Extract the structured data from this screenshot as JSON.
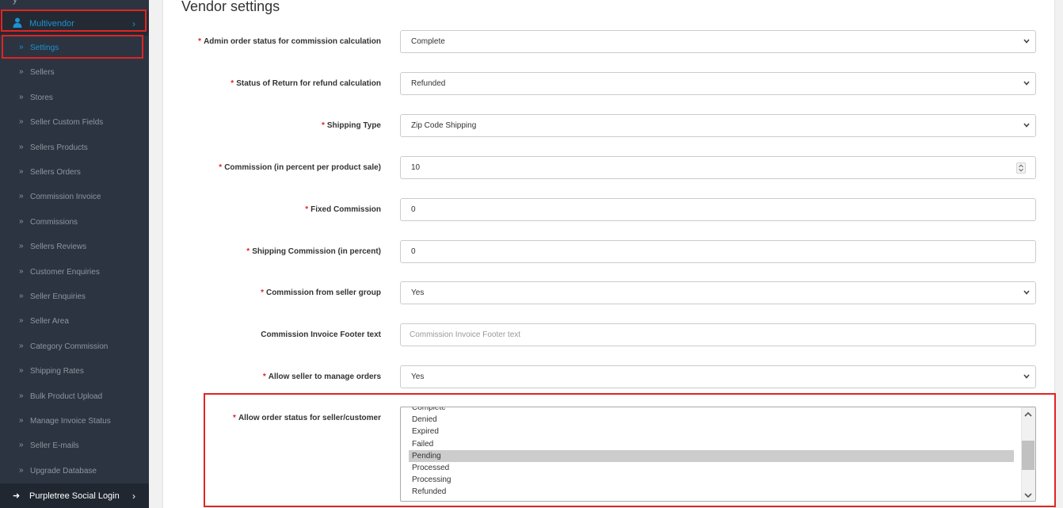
{
  "sidebar": {
    "top_partial": "y",
    "multivendor_label": "Multivendor",
    "items": [
      {
        "label": "Settings",
        "active": true
      },
      {
        "label": "Sellers"
      },
      {
        "label": "Stores"
      },
      {
        "label": "Seller Custom Fields"
      },
      {
        "label": "Sellers Products"
      },
      {
        "label": "Sellers Orders"
      },
      {
        "label": "Commission Invoice"
      },
      {
        "label": "Commissions"
      },
      {
        "label": "Sellers Reviews"
      },
      {
        "label": "Customer Enquiries"
      },
      {
        "label": "Seller Enquiries"
      },
      {
        "label": "Seller Area"
      },
      {
        "label": "Category Commission"
      },
      {
        "label": "Shipping Rates"
      },
      {
        "label": "Bulk Product Upload"
      },
      {
        "label": "Manage Invoice Status"
      },
      {
        "label": "Seller E-mails"
      },
      {
        "label": "Upgrade Database"
      }
    ],
    "social_label": "Purpletree Social Login"
  },
  "main": {
    "title": "Vendor settings",
    "fields": [
      {
        "label": "Admin order status for commission calculation",
        "required": true,
        "type": "select",
        "value": "Complete"
      },
      {
        "label": "Status of Return for refund calculation",
        "required": true,
        "type": "select",
        "value": "Refunded"
      },
      {
        "label": "Shipping Type",
        "required": true,
        "type": "select",
        "value": "Zip Code Shipping"
      },
      {
        "label": "Commission (in percent per product sale)",
        "required": true,
        "type": "number",
        "value": "10"
      },
      {
        "label": "Fixed Commission",
        "required": true,
        "type": "text",
        "value": "0"
      },
      {
        "label": "Shipping Commission (in percent)",
        "required": true,
        "type": "text",
        "value": "0"
      },
      {
        "label": "Commission from seller group",
        "required": true,
        "type": "select",
        "value": "Yes"
      },
      {
        "label": "Commission Invoice Footer text",
        "required": false,
        "type": "text",
        "value": "",
        "placeholder": "Commission Invoice Footer text"
      },
      {
        "label": "Allow seller to manage orders",
        "required": true,
        "type": "select",
        "value": "Yes"
      }
    ],
    "order_status_field": {
      "label": "Allow order status for seller/customer",
      "required": true,
      "options": [
        "Complete",
        "Denied",
        "Expired",
        "Failed",
        "Pending",
        "Processed",
        "Processing",
        "Refunded"
      ],
      "selected": "Pending"
    }
  },
  "colors": {
    "sidebar_bg": "#2b3440",
    "accent": "#1e91cf",
    "required_star": "#e02424",
    "highlight_box": "#e02424"
  }
}
